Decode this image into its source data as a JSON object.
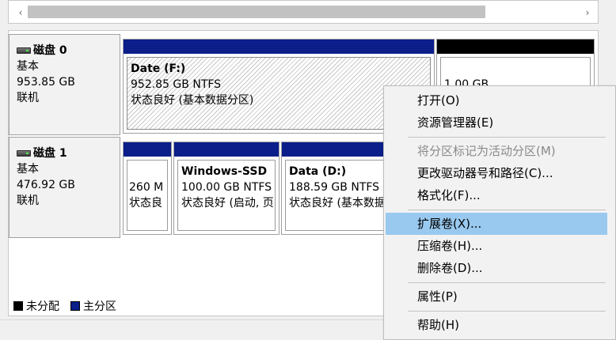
{
  "scrollbar": {
    "left_arrow": "‹",
    "right_arrow": "›"
  },
  "disks": [
    {
      "name": "磁盘 0",
      "type": "基本",
      "size": "953.85 GB",
      "status": "联机",
      "partitions": [
        {
          "title": "Date  (F:)",
          "line1": "952.85 GB NTFS",
          "line2": "状态良好 (基本数据分区)"
        },
        {
          "title": "",
          "line1": "1.00 GB",
          "line2": ""
        }
      ]
    },
    {
      "name": "磁盘 1",
      "type": "基本",
      "size": "476.92 GB",
      "status": "联机",
      "partitions": [
        {
          "title": "",
          "line1": "260 M",
          "line2": "状态良"
        },
        {
          "title": "Windows-SSD",
          "line1": "100.00 GB NTFS",
          "line2": "状态良好 (启动, 页"
        },
        {
          "title": "Data  (D:)",
          "line1": "188.59 GB NTFS",
          "line2": "状态良好 (基本数据"
        }
      ]
    }
  ],
  "legend": {
    "unallocated": "未分配",
    "primary": "主分区"
  },
  "colors": {
    "primary": "#0b1e8a",
    "unallocated": "#000000",
    "menu_highlight": "#99c9ef"
  },
  "context_menu": {
    "open": "打开(O)",
    "explorer": "资源管理器(E)",
    "mark_active": "将分区标记为活动分区(M)",
    "change_letter": "更改驱动器号和路径(C)...",
    "format": "格式化(F)...",
    "extend": "扩展卷(X)...",
    "shrink": "压缩卷(H)...",
    "delete": "删除卷(D)...",
    "properties": "属性(P)",
    "help": "帮助(H)"
  }
}
